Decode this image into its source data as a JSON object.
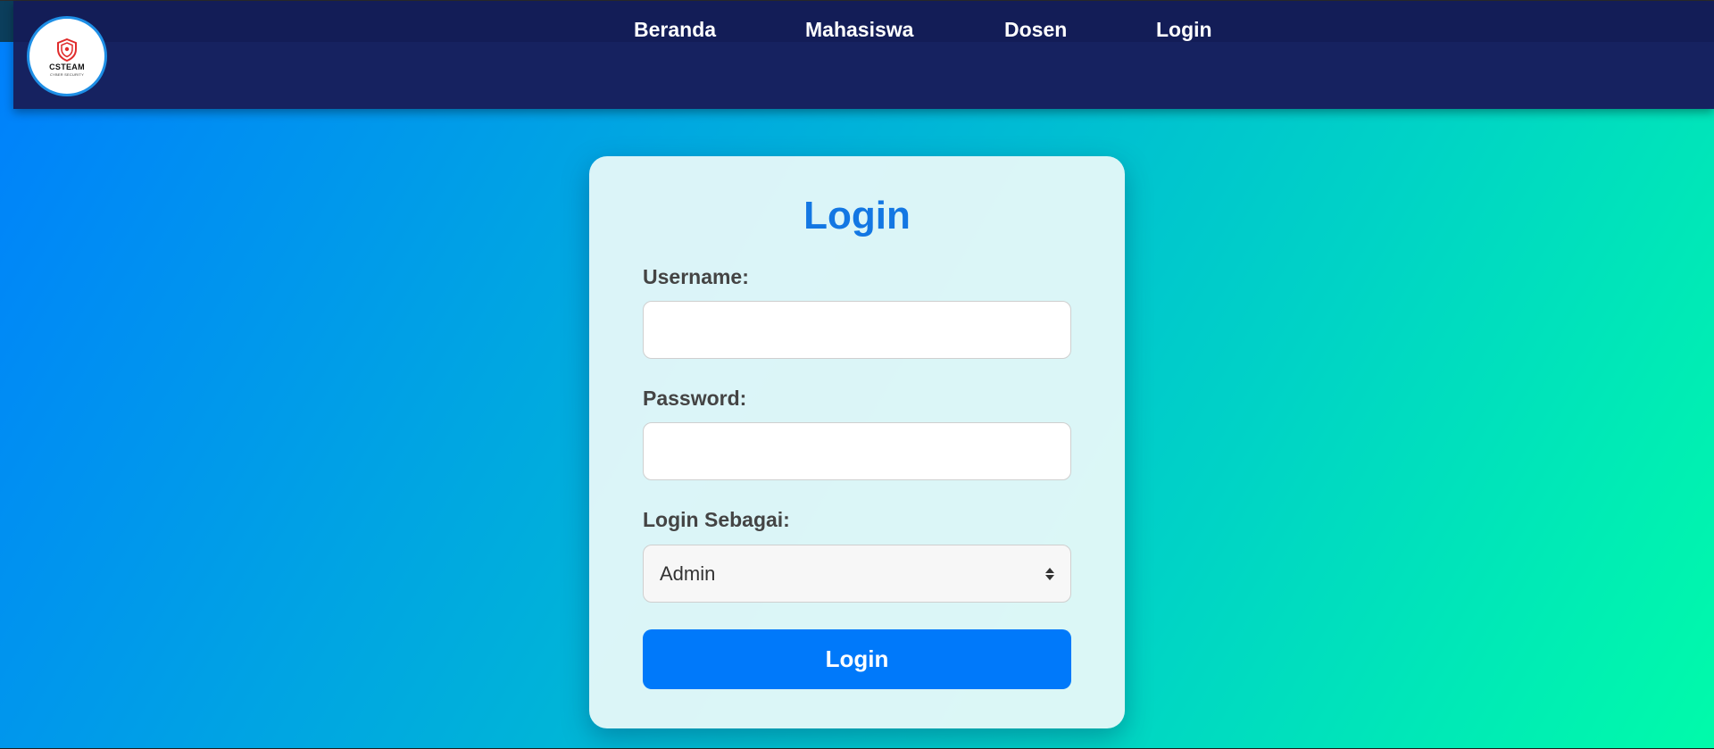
{
  "brand": {
    "logo_name": "CSTEAM",
    "logo_tagline": "CYBER SECURITY"
  },
  "nav": {
    "items": [
      {
        "label": "Beranda"
      },
      {
        "label": "Mahasiswa"
      },
      {
        "label": "Dosen"
      },
      {
        "label": "Login"
      }
    ]
  },
  "form": {
    "title": "Login",
    "username": {
      "label": "Username:",
      "value": "",
      "placeholder": ""
    },
    "password": {
      "label": "Password:",
      "value": "",
      "placeholder": ""
    },
    "role": {
      "label": "Login Sebagai:",
      "selected": "Admin"
    },
    "submit_label": "Login"
  },
  "colors": {
    "navbar": "#162260",
    "title": "#1377e3",
    "button": "#0079fa",
    "background_start": "#007ffd",
    "background_end": "#00fbaa"
  },
  "icons": {
    "logo": "shield-icon",
    "select": "updown-arrows-icon"
  }
}
